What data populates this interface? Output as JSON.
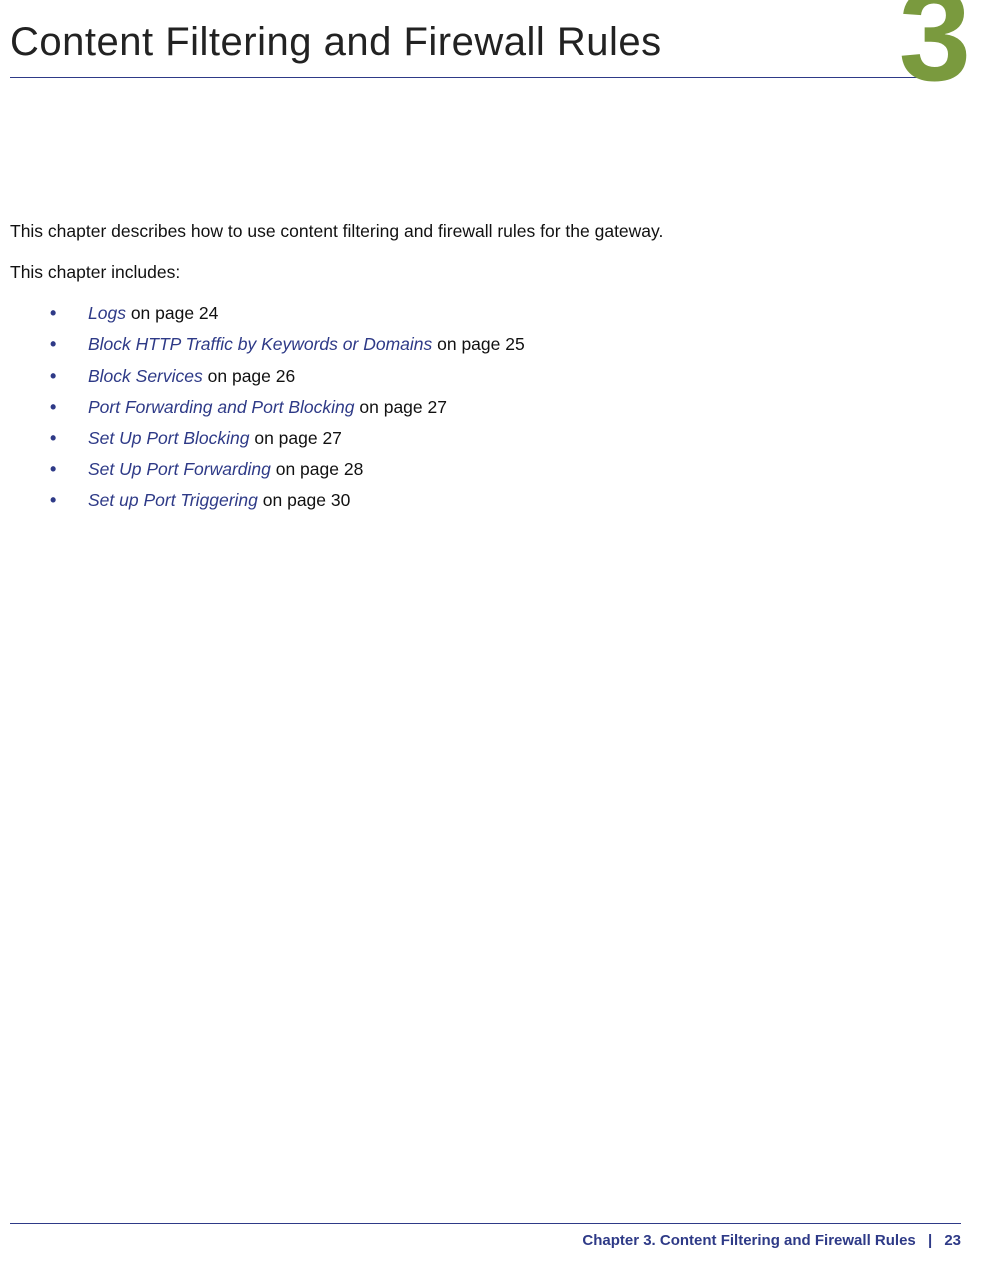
{
  "header": {
    "title": "Content Filtering and Firewall Rules",
    "chapter_number": "3"
  },
  "intro": {
    "line1": "This chapter describes how to use content filtering and firewall rules for the gateway.",
    "line2": "This chapter includes:"
  },
  "toc": [
    {
      "link": "Logs",
      "suffix": " on page 24"
    },
    {
      "link": "Block HTTP Traffic by Keywords or Domains",
      "suffix": " on page 25"
    },
    {
      "link": "Block Services",
      "suffix": " on page 26"
    },
    {
      "link": "Port Forwarding and Port Blocking",
      "suffix": " on page 27"
    },
    {
      "link": "Set Up Port Blocking",
      "suffix": " on page 27"
    },
    {
      "link": "Set Up Port Forwarding",
      "suffix": " on page 28"
    },
    {
      "link": "Set up Port Triggering",
      "suffix": " on page 30"
    }
  ],
  "footer": {
    "chapter_label": "Chapter 3.  Content Filtering and Firewall Rules",
    "separator": "|",
    "page_number": "23"
  },
  "bullet_glyph": "•"
}
